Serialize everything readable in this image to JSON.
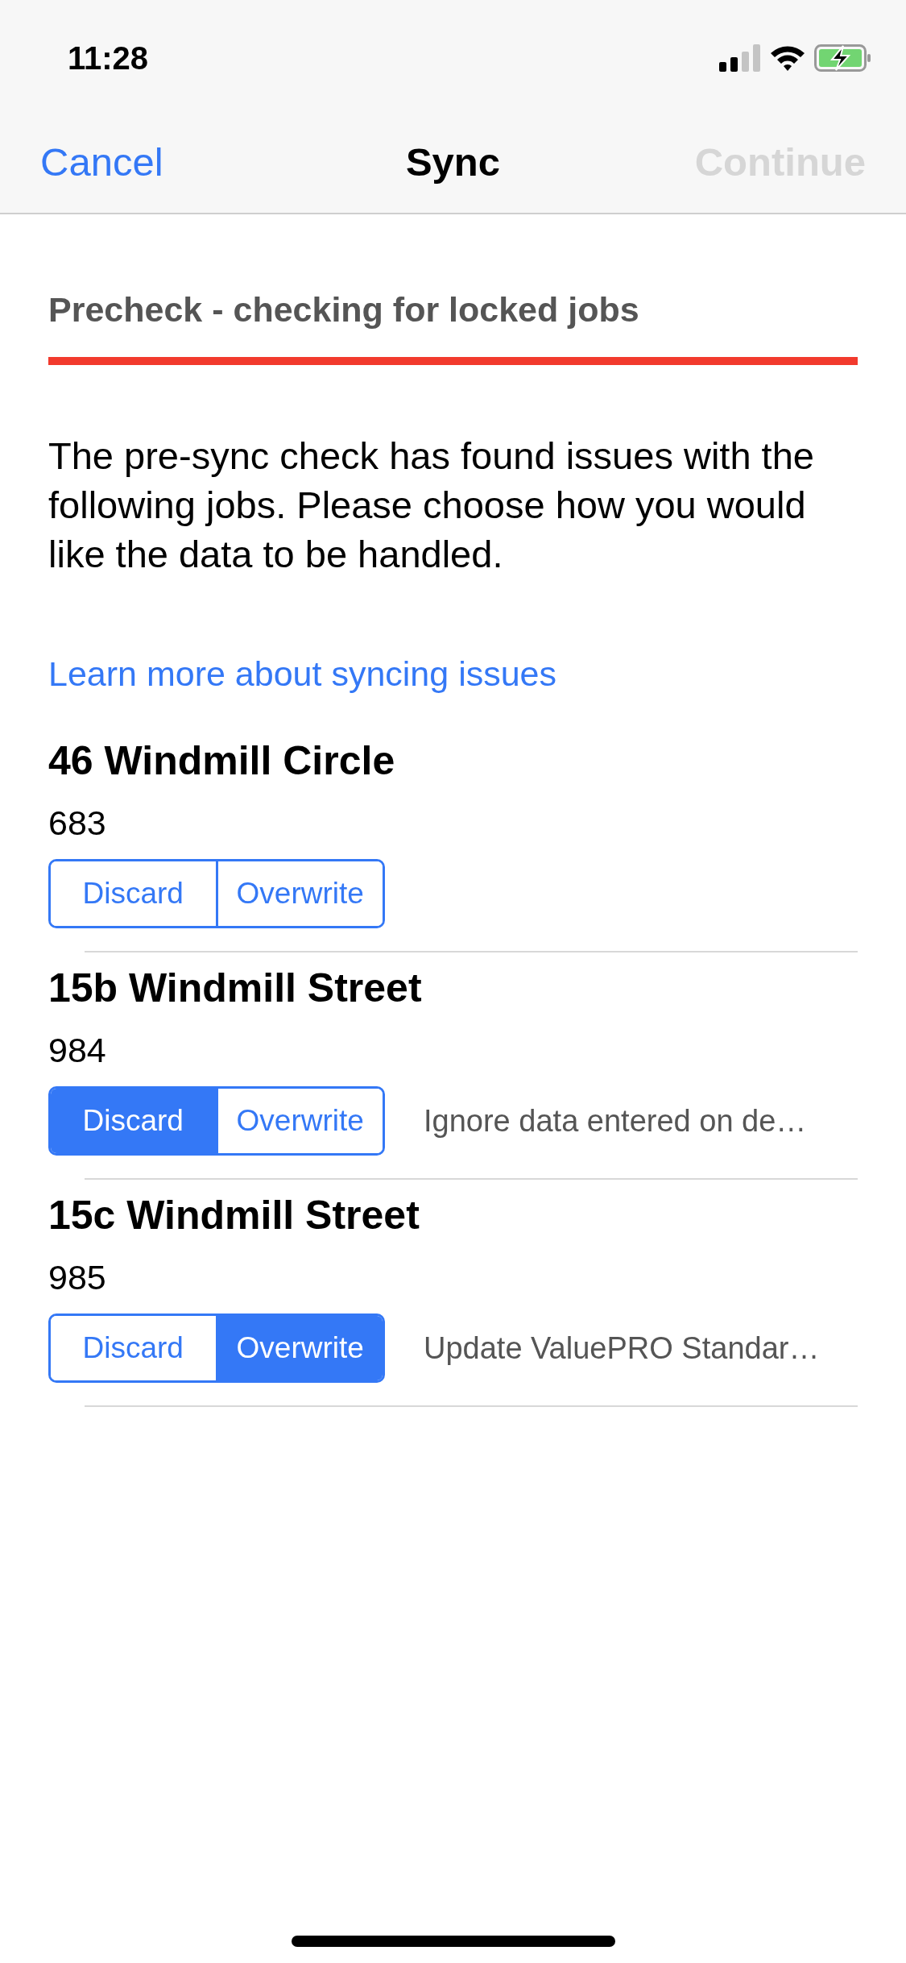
{
  "status_bar": {
    "time": "11:28"
  },
  "nav_bar": {
    "left_button": {
      "label": "Cancel",
      "disabled": false
    },
    "title": "Sync",
    "right_button": {
      "label": "Continue",
      "disabled": true
    }
  },
  "step": {
    "title": "Precheck - checking for locked jobs"
  },
  "message": "The pre-sync check has found issues with the following jobs. Please choose how you would like the data to be handled.",
  "link": "Learn more about syncing issues",
  "jobs": [
    {
      "title": "46 Windmill Circle",
      "number": "683",
      "options": [
        {
          "label": "Discard",
          "selected": false
        },
        {
          "label": "Overwrite",
          "selected": false
        }
      ]
    },
    {
      "title": "15b Windmill Street",
      "number": "984",
      "options": [
        {
          "label": "Discard",
          "selected": true
        },
        {
          "label": "Overwrite",
          "selected": false
        }
      ],
      "description": "Ignore data entered on de…"
    },
    {
      "title": "15c Windmill Street",
      "number": "985",
      "options": [
        {
          "label": "Discard",
          "selected": false
        },
        {
          "label": "Overwrite",
          "selected": true
        }
      ],
      "description": "Update ValuePRO Standar…"
    }
  ]
}
